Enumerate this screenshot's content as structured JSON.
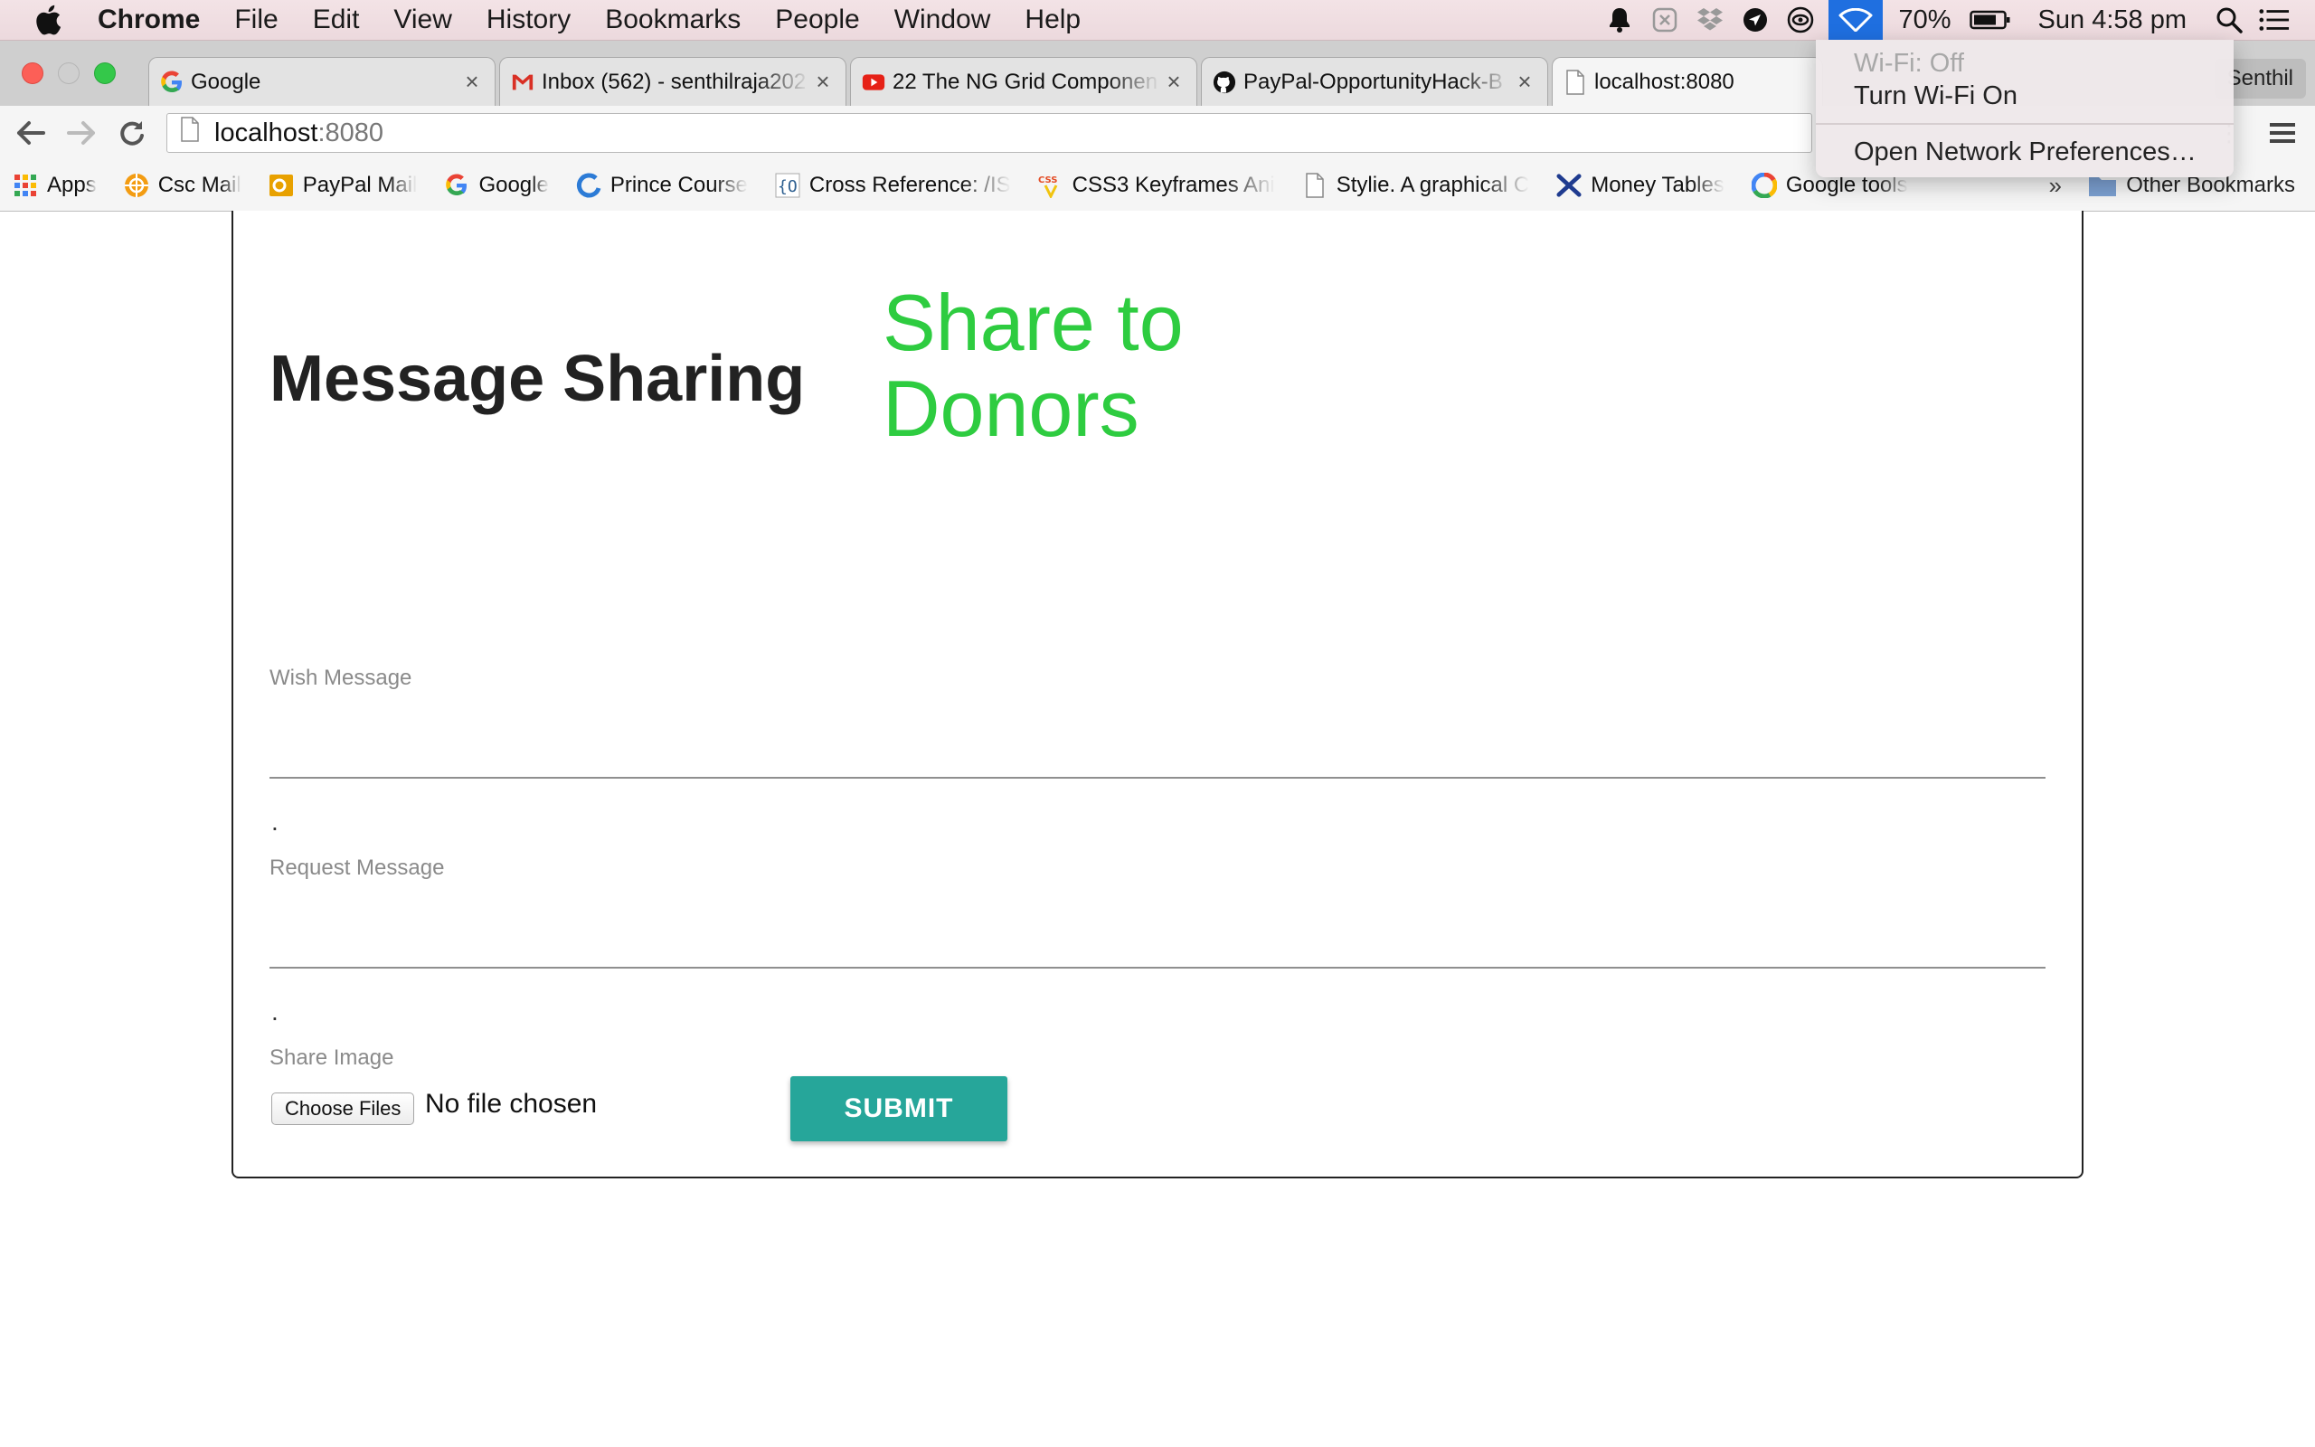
{
  "menubar": {
    "items": [
      "Chrome",
      "File",
      "Edit",
      "View",
      "History",
      "Bookmarks",
      "People",
      "Window",
      "Help"
    ],
    "battery": "70%",
    "clock": "Sun 4:58 pm"
  },
  "wifi_menu": {
    "status": "Wi-Fi: Off",
    "turn_on": "Turn Wi-Fi On",
    "preferences": "Open Network Preferences…"
  },
  "tabs": [
    {
      "title": "Google",
      "favicon": "google-icon"
    },
    {
      "title": "Inbox (562) - senthilraja202",
      "favicon": "gmail-icon"
    },
    {
      "title": "22 The NG Grid Componen",
      "favicon": "youtube-icon"
    },
    {
      "title": "PayPal-OpportunityHack-B",
      "favicon": "github-icon"
    },
    {
      "title": "localhost:8080",
      "favicon": "page-icon"
    }
  ],
  "profile_name": "Senthil",
  "address": {
    "host": "localhost",
    "port": ":8080"
  },
  "bookmarks": [
    {
      "label": "Apps",
      "icon": "apps-icon"
    },
    {
      "label": "Csc Mail",
      "icon": "csc-icon"
    },
    {
      "label": "PayPal Mail",
      "icon": "outlook-icon"
    },
    {
      "label": "Google",
      "icon": "google-icon"
    },
    {
      "label": "Prince Course",
      "icon": "prince-icon"
    },
    {
      "label": "Cross Reference: /IS",
      "icon": "xref-icon"
    },
    {
      "label": "CSS3 Keyframes Ani",
      "icon": "css3-icon"
    },
    {
      "label": "Stylie. A graphical C",
      "icon": "page-icon"
    },
    {
      "label": "Money Tables",
      "icon": "money-icon"
    },
    {
      "label": "Google tools",
      "icon": "google-tools-icon"
    }
  ],
  "bookmarks_more": "»",
  "other_bookmarks": "Other Bookmarks",
  "page": {
    "hero_title": "Share to Donors",
    "section_title": "Message Sharing",
    "wish_label": "Wish Message",
    "request_label": "Request Message",
    "dot1": ".",
    "dot2": ".",
    "image_label": "Share Image",
    "choose_files": "Choose Files",
    "no_file": "No file chosen",
    "submit": "SUBMIT"
  },
  "colors": {
    "hero": "#2ecc40",
    "submit": "#26a69a",
    "wifi_highlight": "#1f6fe0"
  }
}
